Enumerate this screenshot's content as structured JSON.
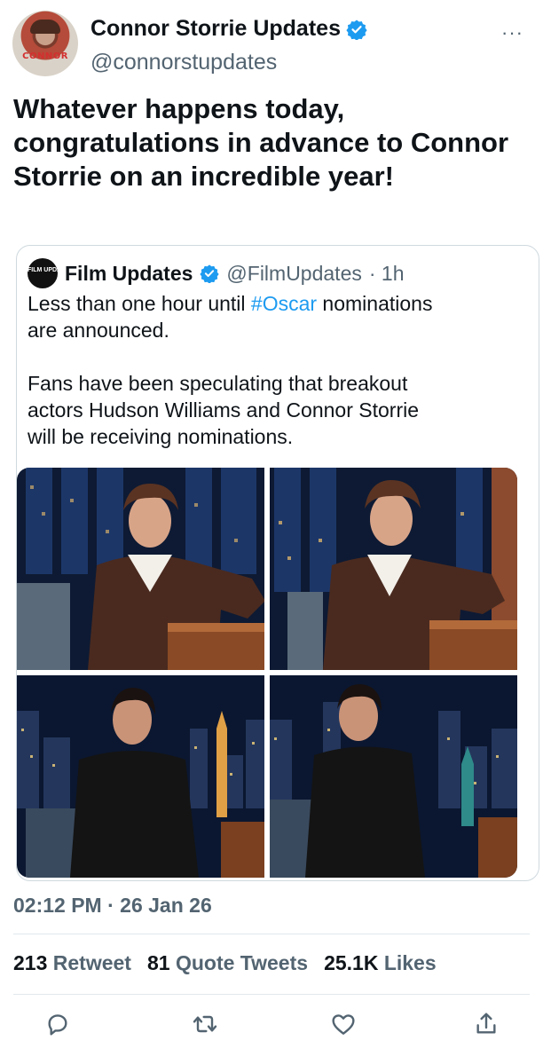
{
  "author": {
    "display_name": "Connor Storrie Updates",
    "handle": "@connorstupdates",
    "avatar_text": "CONNOR",
    "more_label": "···"
  },
  "tweet": {
    "text": "Whatever happens today, congratulations in advance to Connor Storrie on an incredible year!"
  },
  "quoted": {
    "avatar_text": "FILM UPDATES",
    "display_name": "Film Updates",
    "handle": "@FilmUpdates",
    "time": "· 1h",
    "text_part1": "Less than one hour until ",
    "hashtag": "#Oscar",
    "text_part2": " nominations\nare announced.\n\nFans have been speculating that breakout\nactors Hudson Williams and Connor Storrie\nwill be receiving nominations."
  },
  "meta": {
    "timestamp": "02:12 PM · 26 Jan 26"
  },
  "stats": {
    "retweets_count": "213",
    "retweets_label": "Retweet",
    "quotes_count": "81",
    "quotes_label": "Quote Tweets",
    "likes_count": "25.1K",
    "likes_label": "Likes"
  },
  "colors": {
    "accent": "#1d9bf0",
    "secondary_text": "#536471",
    "primary_text": "#0f1419"
  },
  "icons": {
    "reply": "reply-icon",
    "retweet": "retweet-icon",
    "like": "heart-icon",
    "share": "share-icon",
    "verified": "verified-badge-icon"
  }
}
